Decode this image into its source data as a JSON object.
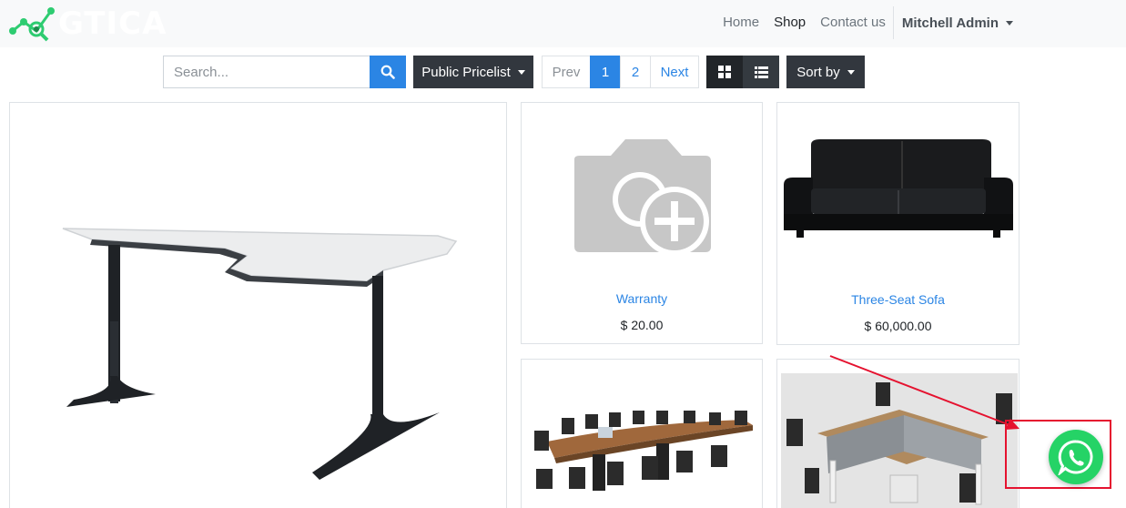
{
  "brand": {
    "name": "GTICA",
    "colors": {
      "logo": "#2ecc71",
      "primary": "#2b85e4",
      "dark_button": "#32373e",
      "whatsapp": "#25d366",
      "annotation": "#e5122f"
    }
  },
  "nav": {
    "links": [
      "Home",
      "Shop",
      "Contact us"
    ],
    "active": "Shop",
    "user": "Mitchell Admin"
  },
  "toolbar": {
    "search_placeholder": "Search...",
    "search_icon": "search-icon",
    "pricelist_label": "Public Pricelist",
    "pager": {
      "prev": "Prev",
      "pages": [
        "1",
        "2"
      ],
      "current": "1",
      "next": "Next"
    },
    "view_icons": [
      "grid-view-icon",
      "list-view-icon"
    ],
    "sort_label": "Sort by"
  },
  "products": [
    {
      "name": "Warranty",
      "price": "$ 20.00",
      "image": "camera-placeholder-icon"
    },
    {
      "name": "Three-Seat Sofa",
      "price": "$ 60,000.00",
      "image": "sofa-image"
    }
  ],
  "whatsapp": {
    "icon": "whatsapp-icon"
  }
}
